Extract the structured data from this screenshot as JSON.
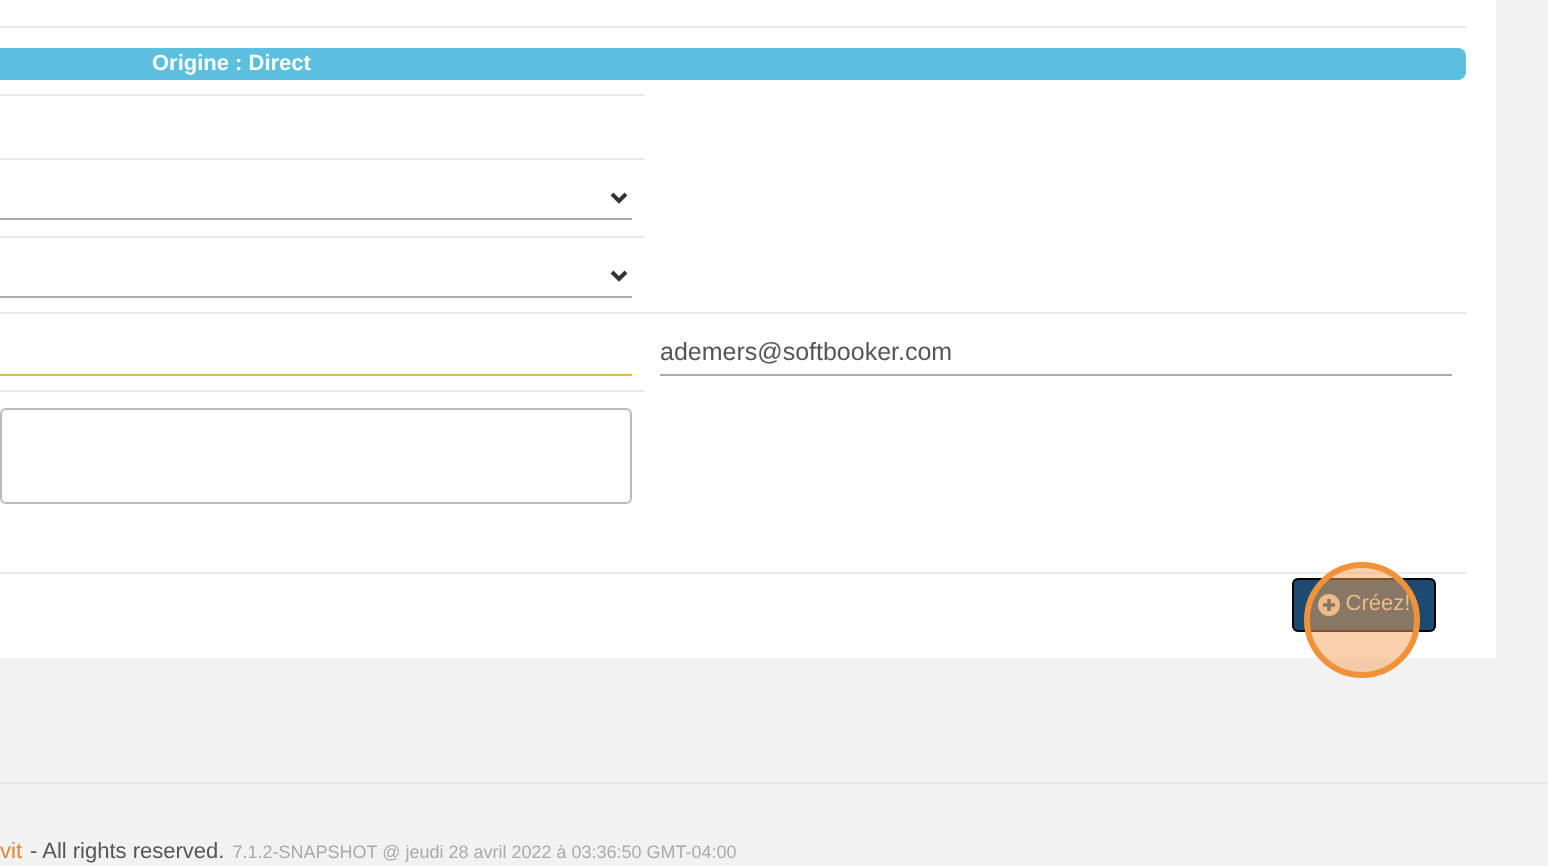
{
  "banner": {
    "text": "Origine : Direct"
  },
  "form": {
    "fields": [
      {
        "kind": "blank",
        "focused": false
      },
      {
        "kind": "select",
        "focused": false
      },
      {
        "kind": "select",
        "focused": false
      },
      {
        "kind": "input",
        "focused": true,
        "side_value": "ademers@softbooker.com"
      },
      {
        "kind": "textarea",
        "focused": false
      }
    ]
  },
  "create_button": {
    "label": "Créez!"
  },
  "footer": {
    "company": "vit",
    "rights": "- All rights reserved.",
    "version": "7.1.2-SNAPSHOT @ jeudi 28 avril 2022 à 03:36:50 GMT-04:00"
  }
}
